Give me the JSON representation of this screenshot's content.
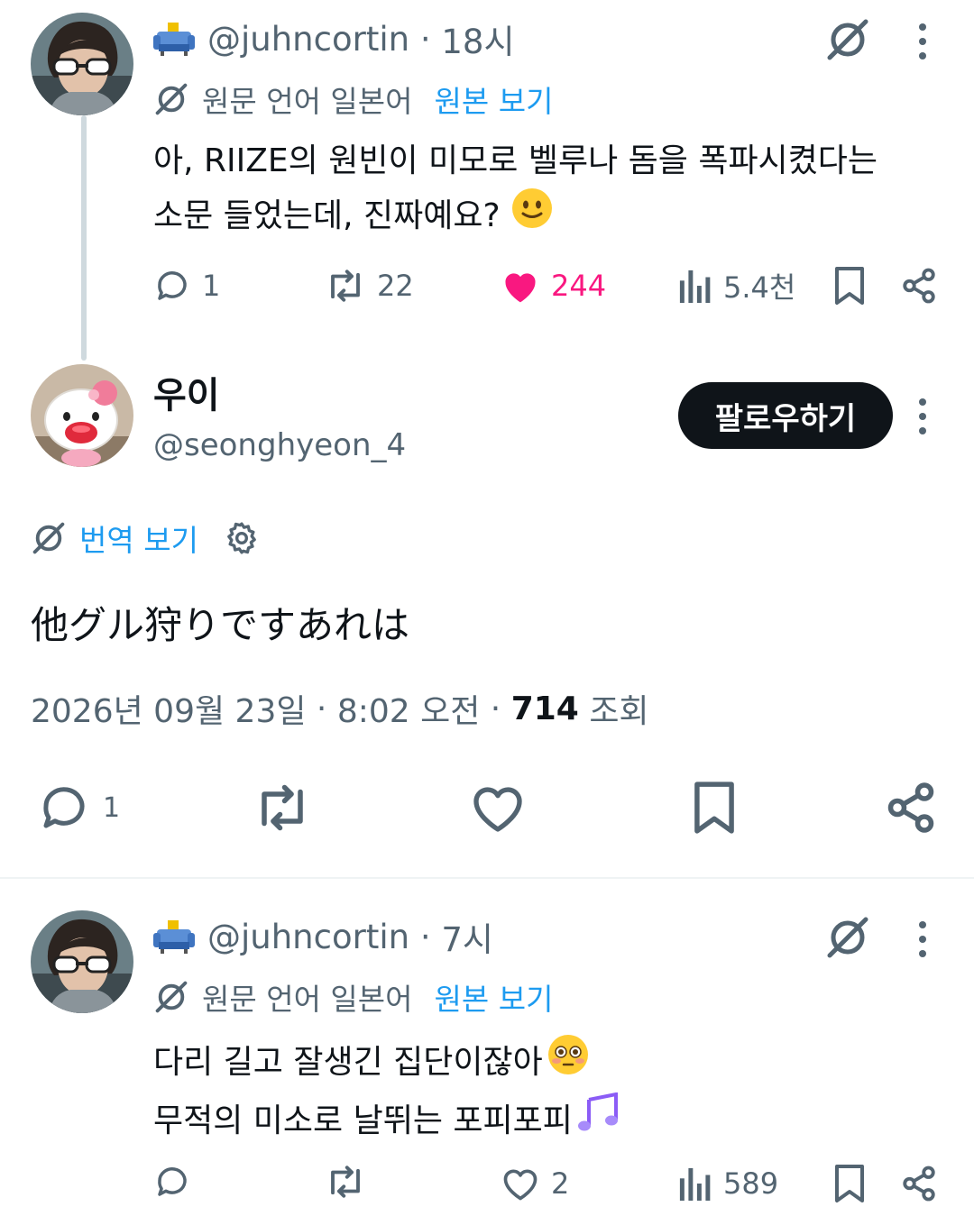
{
  "reply1": {
    "handle": "@juhncortin",
    "time": "18시",
    "translate_note": "원문 언어 일본어",
    "show_original": "원본 보기",
    "text_line1": "아, RIIZE의 원빈이 미모로 벨루나 돔을 폭파시켰다는",
    "text_line2": "소문 들었는데, 진짜예요?",
    "replies": "1",
    "retweets": "22",
    "likes": "244",
    "views": "5.4천",
    "liked": true
  },
  "main": {
    "display_name": "우이",
    "handle": "@seonghyeon_4",
    "follow_label": "팔로우하기",
    "translate_label": "번역 보기",
    "text": "他グル狩りですあれは",
    "date": "2026년 09월 23일",
    "time": "8:02 오전",
    "view_count": "714",
    "view_label": "조회",
    "replies": "1"
  },
  "reply2": {
    "handle": "@juhncortin",
    "time": "7시",
    "translate_note": "원문 언어 일본어",
    "show_original": "원본 보기",
    "text_line1": "다리 길고 잘생긴 집단이잖아",
    "text_line2": "무적의 미소로 날뛰는 포피포피",
    "likes": "2",
    "views": "589"
  },
  "colors": {
    "accent": "#1d9bf0",
    "like": "#f91880",
    "muted": "#536471",
    "text": "#0f1419"
  }
}
